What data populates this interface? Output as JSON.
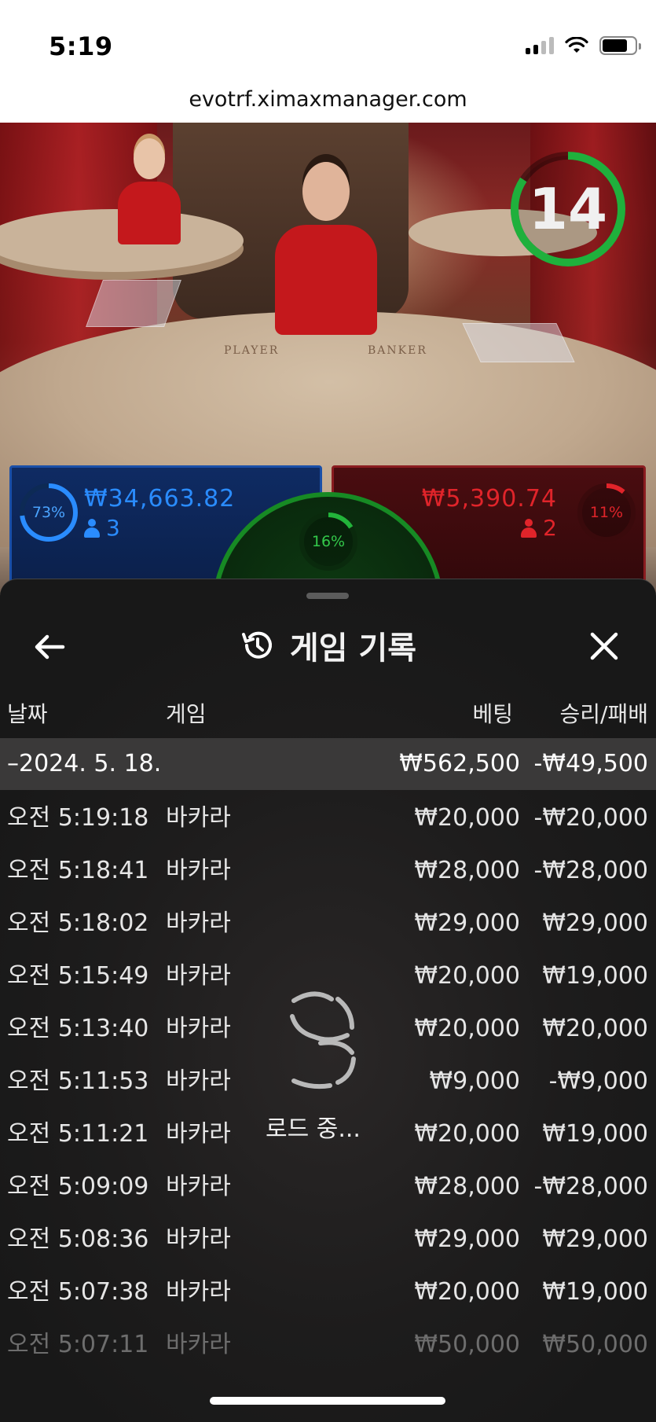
{
  "status_bar": {
    "time": "5:19"
  },
  "browser": {
    "url": "evotrf.ximaxmanager.com"
  },
  "video": {
    "timer": "14",
    "table_text_player": "PLAYER",
    "table_text_banker": "BANKER"
  },
  "bets": {
    "player": {
      "percent": "73%",
      "amount": "₩34,663.82",
      "players": "3",
      "color": "#2a8cff",
      "fill": 0.73
    },
    "banker": {
      "percent": "11%",
      "amount": "₩5,390.74",
      "players": "2",
      "color": "#e0242a",
      "fill": 0.11
    },
    "tie": {
      "percent": "16%",
      "color": "#22b33a",
      "fill": 0.16
    }
  },
  "history": {
    "title": "게임 기록",
    "columns": {
      "date": "날짜",
      "game": "게임",
      "bet": "베팅",
      "result": "승리/패배"
    },
    "date_group": {
      "date": "–2024. 5. 18.",
      "bet_total": "₩562,500",
      "result_total": "-₩49,500"
    },
    "rows": [
      {
        "time": "오전 5:19:18",
        "game": "바카라",
        "bet": "₩20,000",
        "result": "-₩20,000"
      },
      {
        "time": "오전 5:18:41",
        "game": "바카라",
        "bet": "₩28,000",
        "result": "-₩28,000"
      },
      {
        "time": "오전 5:18:02",
        "game": "바카라",
        "bet": "₩29,000",
        "result": "₩29,000"
      },
      {
        "time": "오전 5:15:49",
        "game": "바카라",
        "bet": "₩20,000",
        "result": "₩19,000"
      },
      {
        "time": "오전 5:13:40",
        "game": "바카라",
        "bet": "₩20,000",
        "result": "₩20,000"
      },
      {
        "time": "오전 5:11:53",
        "game": "바카라",
        "bet": "₩9,000",
        "result": "-₩9,000"
      },
      {
        "time": "오전 5:11:21",
        "game": "바카라",
        "bet": "₩20,000",
        "result": "₩19,000"
      },
      {
        "time": "오전 5:09:09",
        "game": "바카라",
        "bet": "₩28,000",
        "result": "-₩28,000"
      },
      {
        "time": "오전 5:08:36",
        "game": "바카라",
        "bet": "₩29,000",
        "result": "₩29,000"
      },
      {
        "time": "오전 5:07:38",
        "game": "바카라",
        "bet": "₩20,000",
        "result": "₩19,000"
      },
      {
        "time": "오전 5:07:11",
        "game": "바카라",
        "bet": "₩50,000",
        "result": "₩50,000"
      }
    ],
    "loading_text": "로드 중..."
  },
  "icons": {
    "back": "arrow-left-icon",
    "close": "close-icon",
    "history": "history-icon",
    "loader": "loading-spinner-icon"
  }
}
